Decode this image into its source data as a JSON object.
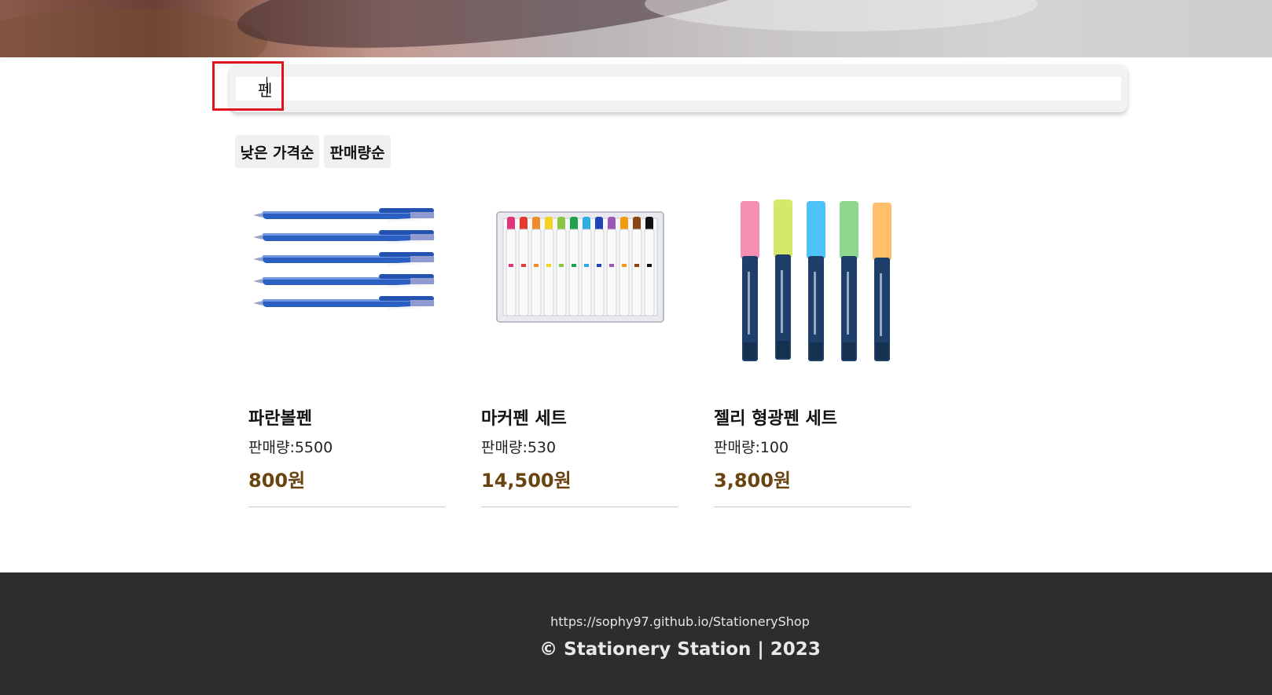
{
  "search": {
    "value": "펜",
    "placeholder": ""
  },
  "sort_buttons": {
    "low_price": "낮은 가격순",
    "sales": "판매량순"
  },
  "products": [
    {
      "name": "파란볼펜",
      "sales_label": "판매량:",
      "sales": "5500",
      "price": "800원",
      "image": "blue-ballpoint-pens-image"
    },
    {
      "name": "마커펜 세트",
      "sales_label": "판매량:",
      "sales": "530",
      "price": "14,500원",
      "image": "marker-pen-set-image"
    },
    {
      "name": "젤리 형광펜 세트",
      "sales_label": "판매량:",
      "sales": "100",
      "price": "3,800원",
      "image": "jelly-highlighter-set-image"
    }
  ],
  "footer": {
    "url": "https://sophy97.github.io/StationeryShop",
    "copyright": "© Stationery Station | 2023"
  },
  "colors": {
    "price": "#6a4410",
    "footer_bg": "#2d2d2d",
    "highlight": "#e0141e"
  }
}
